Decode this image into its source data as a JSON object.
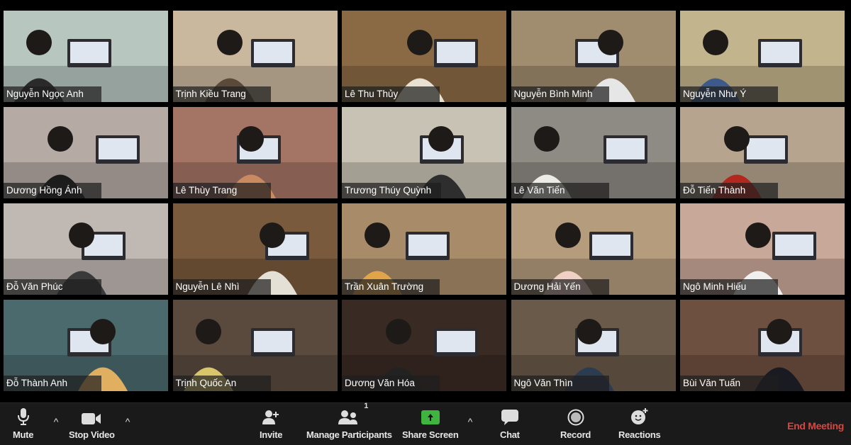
{
  "participants": [
    {
      "name": "Nguyễn Ngọc Anh",
      "bg": "#b8c6c0",
      "accent": "#2a2a2a"
    },
    {
      "name": "Trịnh Kiều Trang",
      "bg": "#c9b79e",
      "accent": "#5b4a3a"
    },
    {
      "name": "Lê Thu Thủy",
      "bg": "#8a6a44",
      "accent": "#e8e0d0"
    },
    {
      "name": "Nguyễn Bình Minh",
      "bg": "#a08c6e",
      "accent": "#e6e6e6"
    },
    {
      "name": "Nguyễn Như Ý",
      "bg": "#c2b48c",
      "accent": "#3d5a8a"
    },
    {
      "name": "Dương Hồng Ánh",
      "bg": "#b6aaa4",
      "accent": "#1c1c1c"
    },
    {
      "name": "Lê Thùy Trang",
      "bg": "#a47464",
      "accent": "#c98a62"
    },
    {
      "name": "Trương Thúy Quỳnh",
      "bg": "#c8c2b4",
      "accent": "#2e2e2e"
    },
    {
      "name": "Lê Văn Tiến",
      "bg": "#8e8a84",
      "accent": "#ecebe6"
    },
    {
      "name": "Đỗ Tiến Thành",
      "bg": "#b6a48e",
      "accent": "#b3281e"
    },
    {
      "name": "Đỗ Văn Phúc",
      "bg": "#c0b8b2",
      "accent": "#3a3a3a"
    },
    {
      "name": "Nguyễn Lê Nhì",
      "bg": "#7a5a3c",
      "accent": "#e5e0d6"
    },
    {
      "name": "Trần Xuân Trường",
      "bg": "#a88c6a",
      "accent": "#e2a44a"
    },
    {
      "name": "Dương Hải Yến",
      "bg": "#b49c7c",
      "accent": "#f0d0c4"
    },
    {
      "name": "Ngô Minh Hiếu",
      "bg": "#c8a898",
      "accent": "#f0f0f0"
    },
    {
      "name": "Đỗ Thành Anh",
      "bg": "#4a6a6e",
      "accent": "#e0b060"
    },
    {
      "name": "Trịnh Quốc An",
      "bg": "#5a4a3e",
      "accent": "#d8c66a"
    },
    {
      "name": "Dương Văn Hóa",
      "bg": "#3a2a24",
      "accent": "#222222"
    },
    {
      "name": "Ngô Văn Thìn",
      "bg": "#6a5a4a",
      "accent": "#2c3c50"
    },
    {
      "name": "Bùi Văn Tuấn",
      "bg": "#6e5040",
      "accent": "#1a1a22"
    }
  ],
  "toolbar": {
    "mute": "Mute",
    "stop_video": "Stop Video",
    "invite": "Invite",
    "manage_participants": "Manage Participants",
    "participant_count": "1",
    "share_screen": "Share Screen",
    "chat": "Chat",
    "record": "Record",
    "reactions": "Reactions",
    "end_meeting": "End Meeting",
    "caret": "^"
  },
  "colors": {
    "share_green": "#3fb53f",
    "end_red": "#d9473f"
  }
}
